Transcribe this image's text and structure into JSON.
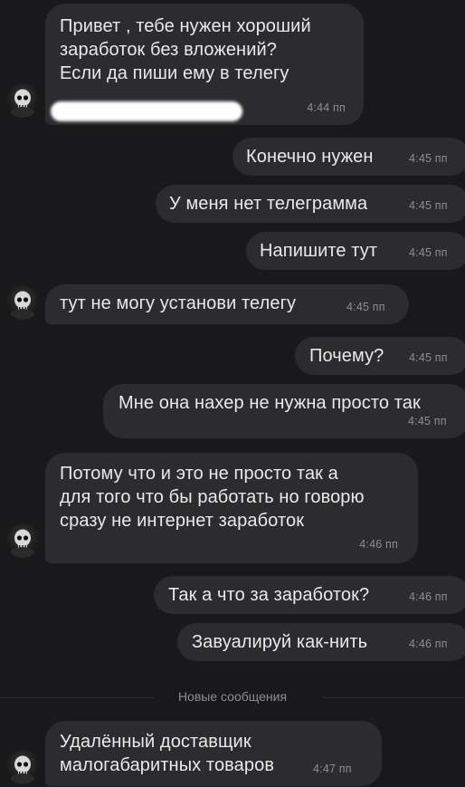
{
  "messages": [
    {
      "text": "Привет , тебе нужен хороший\nзаработок без вложений?\nЕсли да пиши ему в телегу",
      "time": "4:44 пп"
    },
    {
      "text": "Конечно нужен",
      "time": "4:45 пп"
    },
    {
      "text": "У меня нет телеграмма",
      "time": "4:45 пп"
    },
    {
      "text": "Напишите тут",
      "time": "4:45 пп"
    },
    {
      "text": "тут не могу установи телегу",
      "time": "4:45 пп"
    },
    {
      "text": "Почему?",
      "time": "4:45 пп"
    },
    {
      "text": "Мне она нахер не нужна просто так",
      "time": "4:45 пп"
    },
    {
      "text": "Потому что и это не просто так а\nдля того что бы работать но говорю\nсразу не интернет заработок",
      "time": "4:46 пп"
    },
    {
      "text": "Так а что за заработок?",
      "time": "4:46 пп"
    },
    {
      "text": "Завуалируй как-нить",
      "time": "4:46 пп"
    },
    {
      "text": "Удалённый доставщик\nмалогабаритных товаров",
      "time": "4:47 пп"
    }
  ],
  "new_messages_label": "Новые сообщения",
  "icons": {
    "avatar": "skull-avatar-icon"
  },
  "colors": {
    "background": "#19191b",
    "bubble": "#2c2c2e",
    "time": "#8e8e93"
  }
}
